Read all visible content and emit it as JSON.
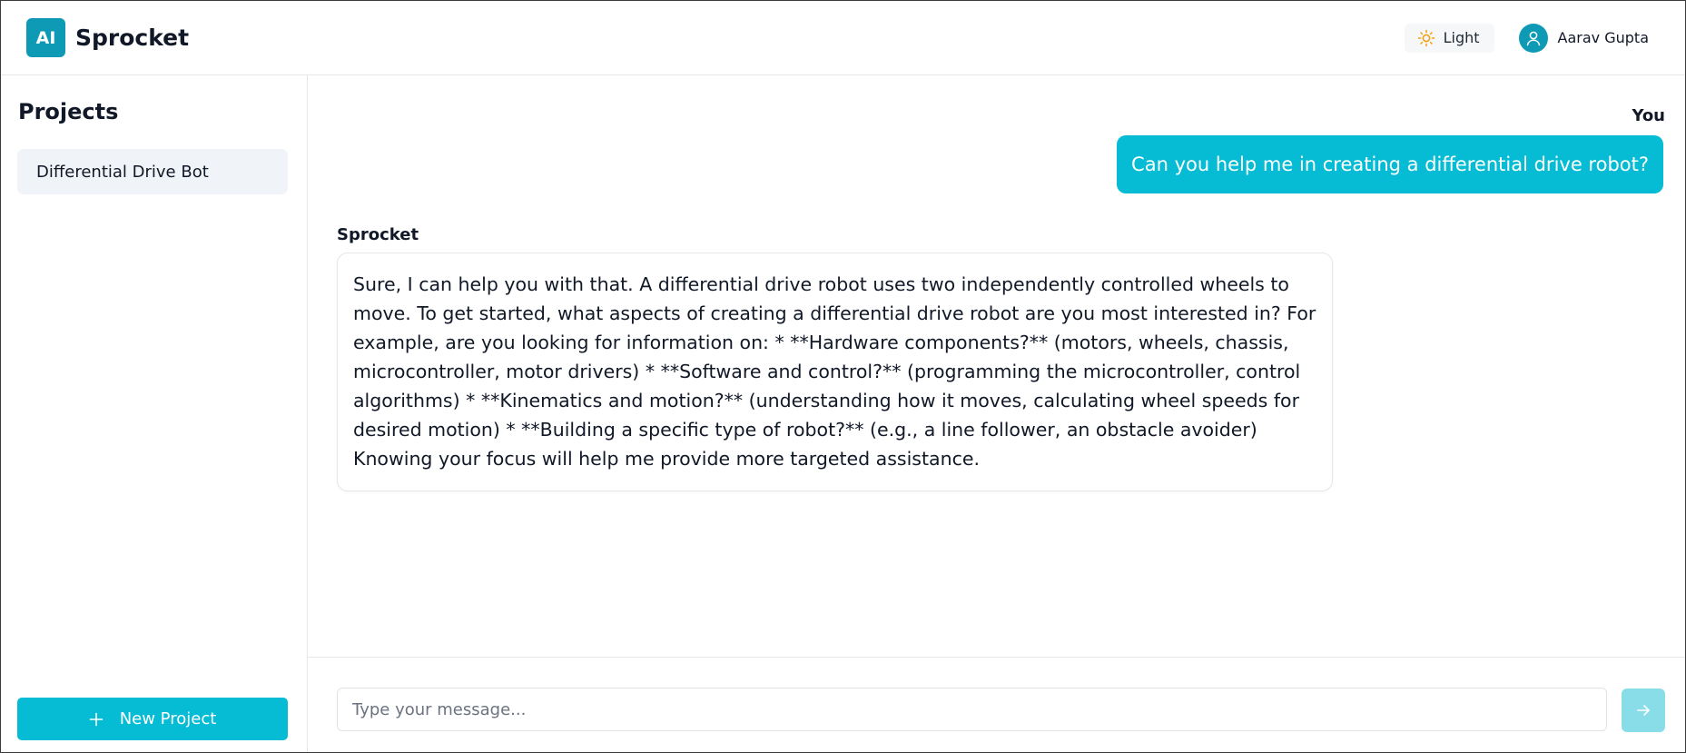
{
  "header": {
    "logo_text": "AI",
    "app_name": "Sprocket",
    "theme_label": "Light",
    "theme_icon": "sun-icon",
    "user_name": "Aarav Gupta",
    "user_icon": "user-icon"
  },
  "sidebar": {
    "title": "Projects",
    "projects": [
      {
        "label": "Differential Drive Bot"
      }
    ],
    "new_project_label": "New Project",
    "new_project_icon": "plus-icon"
  },
  "chat": {
    "messages": [
      {
        "sender": "You",
        "text": "Can you help me in creating a differential drive robot?"
      },
      {
        "sender": "Sprocket",
        "text": "Sure, I can help you with that. A differential drive robot uses two independently controlled wheels to move. To get started, what aspects of creating a differential drive robot are you most interested in? For example, are you looking for information on: * **Hardware components?** (motors, wheels, chassis, microcontroller, motor drivers) * **Software and control?** (programming the microcontroller, control algorithms) * **Kinematics and motion?** (understanding how it moves, calculating wheel speeds for desired motion) * **Building a specific type of robot?** (e.g., a line follower, an obstacle avoider) Knowing your focus will help me provide more targeted assistance."
      }
    ]
  },
  "composer": {
    "placeholder": "Type your message...",
    "value": "",
    "send_icon": "arrow-right-icon"
  },
  "colors": {
    "brand": "#0e9ab5",
    "accent": "#06bcd4",
    "send_disabled": "#88dde8",
    "sun": "#f59e0b"
  }
}
